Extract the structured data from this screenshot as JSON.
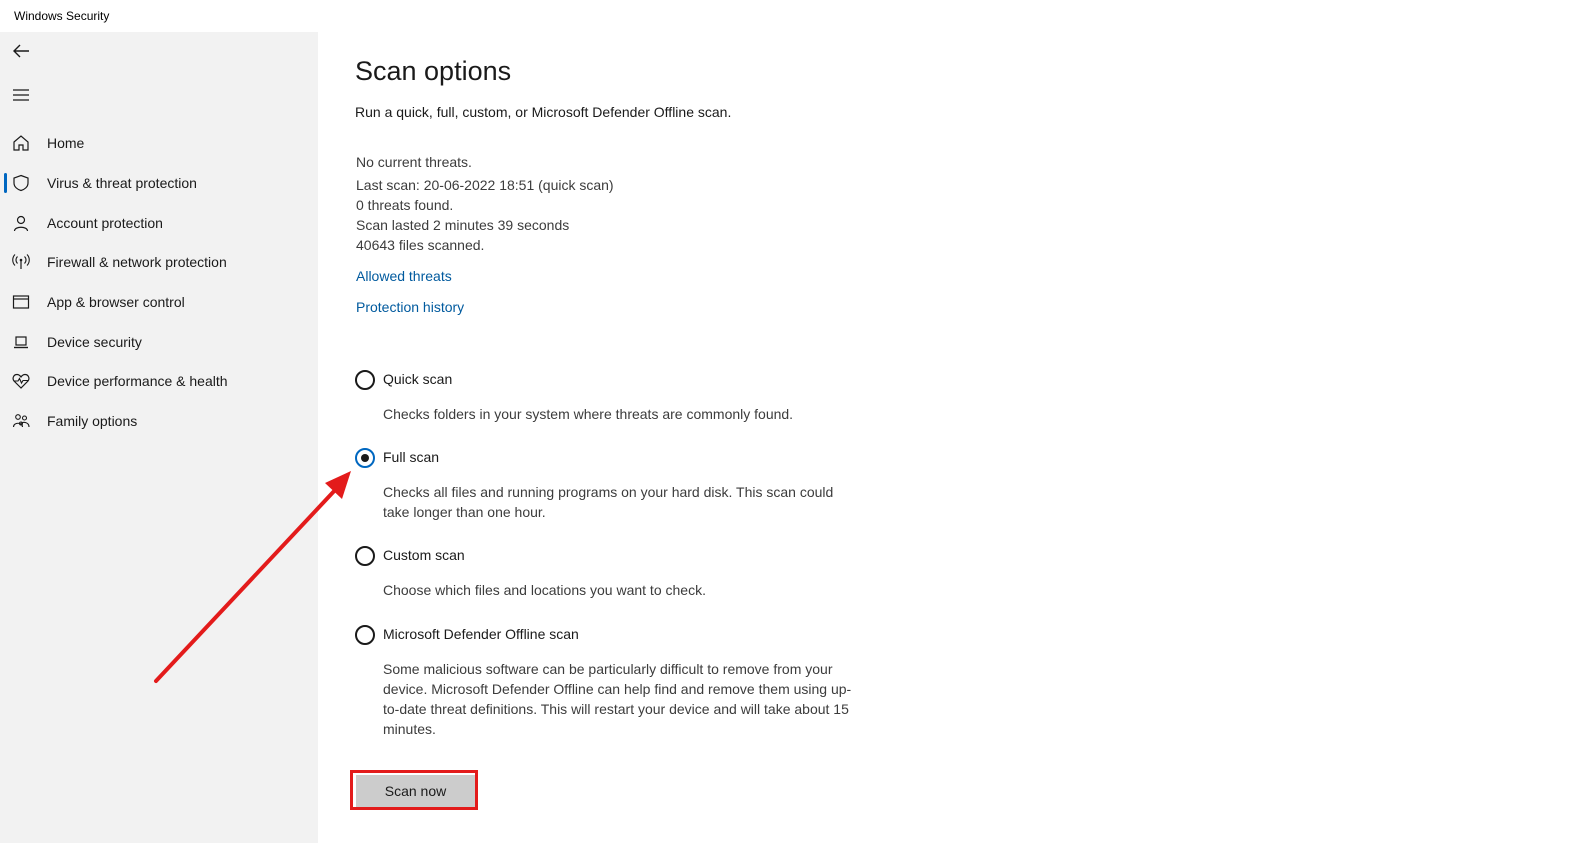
{
  "window": {
    "title": "Windows Security"
  },
  "sidebar": {
    "back_icon": "back-arrow-icon",
    "menu_icon": "hamburger-menu-icon",
    "items": [
      {
        "label": "Home",
        "icon": "home-icon",
        "active": false
      },
      {
        "label": "Virus & threat protection",
        "icon": "shield-icon",
        "active": true
      },
      {
        "label": "Account protection",
        "icon": "person-icon",
        "active": false
      },
      {
        "label": "Firewall & network protection",
        "icon": "antenna-icon",
        "active": false
      },
      {
        "label": "App & browser control",
        "icon": "browser-window-icon",
        "active": false
      },
      {
        "label": "Device security",
        "icon": "laptop-icon",
        "active": false
      },
      {
        "label": "Device performance & health",
        "icon": "heart-pulse-icon",
        "active": false
      },
      {
        "label": "Family options",
        "icon": "family-icon",
        "active": false
      }
    ],
    "accent_color": "#0067c0"
  },
  "main": {
    "title": "Scan options",
    "subtitle": "Run a quick, full, custom, or Microsoft Defender Offline scan.",
    "status": {
      "threats": "No current threats.",
      "last_scan": "Last scan: 20-06-2022 18:51 (quick scan)",
      "found": "0 threats found.",
      "duration": "Scan lasted 2 minutes 39 seconds",
      "files": "40643 files scanned."
    },
    "links": {
      "allowed_threats": "Allowed threats",
      "protection_history": "Protection history"
    },
    "options": [
      {
        "label": "Quick scan",
        "description": "Checks folders in your system where threats are commonly found.",
        "selected": false
      },
      {
        "label": "Full scan",
        "description": "Checks all files and running programs on your hard disk. This scan could take longer than one hour.",
        "selected": true
      },
      {
        "label": "Custom scan",
        "description": "Choose which files and locations you want to check.",
        "selected": false
      },
      {
        "label": "Microsoft Defender Offline scan",
        "description": "Some malicious software can be particularly difficult to remove from your device. Microsoft Defender Offline can help find and remove them using up-to-date threat definitions. This will restart your device and will take about 15 minutes.",
        "selected": false
      }
    ],
    "scan_button": "Scan now"
  },
  "annotations": {
    "color": "#e31b1b",
    "arrow_target": "full-scan-radio",
    "highlight_target": "scan-now-button"
  }
}
